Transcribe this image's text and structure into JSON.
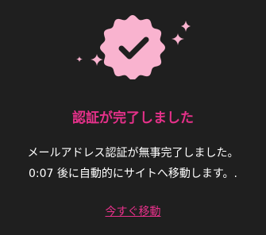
{
  "icon": {
    "name": "verified-check-icon",
    "accent": "#f9b3cf",
    "check_color": "#1f1f1f"
  },
  "title": "認証が完了しました",
  "message": {
    "line1": "メールアドレス認証が無事完了しました。",
    "countdown": "0:07",
    "line2_suffix": " 後に自動的にサイトへ移動します。."
  },
  "link_label": "今すぐ移動",
  "colors": {
    "background": "#1f1f1f",
    "accent": "#e6318a",
    "text": "#ffffff"
  }
}
